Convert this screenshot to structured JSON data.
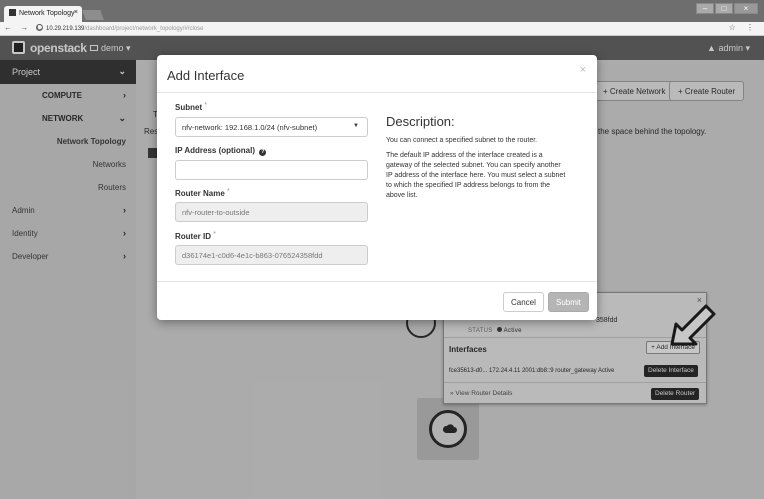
{
  "browser": {
    "tab_title": "Network Topology",
    "tab_close": "×",
    "url_host": "10.29.219.139",
    "url_path": "/dashboard/project/network_topology/#/close",
    "nav_glyphs": "← → C",
    "right_glyphs": "☆ ⋮"
  },
  "header": {
    "brand": "openstack",
    "project_selector": "demo ▾",
    "user_menu": "▲ admin ▾"
  },
  "sidebar": {
    "project": "Project",
    "compute": "COMPUTE",
    "network": "NETWORK",
    "network_topology": "Network Topology",
    "networks": "Networks",
    "routers": "Routers",
    "admin": "Admin",
    "identity": "Identity",
    "developer": "Developer",
    "chev_open": "⌄",
    "chev_closed": "›"
  },
  "main": {
    "create_network": "+ Create Network",
    "create_router": "+ Create Router",
    "topology_note": "the space behind the topology.",
    "frag_t": "T",
    "frag_res": "Res"
  },
  "router_popup": {
    "close": "×",
    "id_fragment": "358fdd",
    "status_label": "STATUS",
    "status_value": "Active",
    "interfaces_title": "Interfaces",
    "add_interface": "+ Add Interface",
    "interface_row": "fce35613-d0...   172.24.4.11 2001:db8::9  router_gateway  Active",
    "delete_interface": "Delete Interface",
    "view_details": "» View Router Details",
    "delete_router": "Delete Router"
  },
  "modal": {
    "title": "Add Interface",
    "close": "×",
    "subnet_label": "Subnet",
    "subnet_value": "nfv-network: 192.168.1.0/24 (nfv-subnet)",
    "ip_label": "IP Address (optional)",
    "ip_value": "",
    "router_name_label": "Router Name",
    "router_name_value": "nfv-router-to-outside",
    "router_id_label": "Router ID",
    "router_id_value": "d36174e1-c0d6-4e1c-b863-076524358fdd",
    "required_mark": "*",
    "description_title": "Description:",
    "description_p1": "You can connect a specified subnet to the router.",
    "description_p2": "The default IP address of the interface created is a gateway of the selected subnet. You can specify another IP address of the interface here. You must select a subnet to which the specified IP address belongs to from the above list.",
    "cancel": "Cancel",
    "submit": "Submit"
  }
}
